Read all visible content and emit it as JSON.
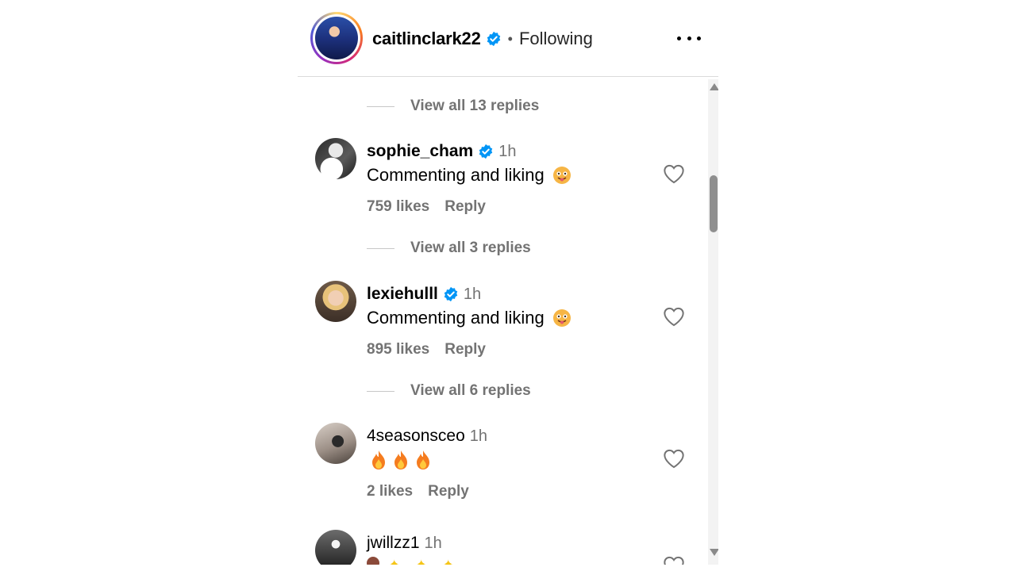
{
  "header": {
    "username": "caitlinclark22",
    "separator": "•",
    "follow_status": "Following",
    "more_label": "More options"
  },
  "threads": [
    {
      "view_replies": "View all 13 replies"
    },
    {
      "view_replies": "View all 3 replies"
    },
    {
      "view_replies": "View all 6 replies"
    }
  ],
  "comments": [
    {
      "username": "sophie_cham",
      "verified": true,
      "time": "1h",
      "text": "Commenting and liking",
      "emoji": "face-with-tongue",
      "likes": "759 likes",
      "reply": "Reply"
    },
    {
      "username": "lexiehulll",
      "verified": true,
      "time": "1h",
      "text": "Commenting and liking",
      "emoji": "face-with-tongue",
      "likes": "895 likes",
      "reply": "Reply"
    },
    {
      "username": "4seasonsceo",
      "verified": false,
      "time": "1h",
      "text": "",
      "emoji": "fire x3",
      "likes": "2 likes",
      "reply": "Reply"
    },
    {
      "username": "jwillzz1",
      "verified": false,
      "time": "1h",
      "text": "",
      "emoji": "partially visible",
      "likes": "",
      "reply": ""
    }
  ],
  "colors": {
    "verified_blue": "#0095f6",
    "secondary_text": "#737373",
    "divider": "#dbdbdb"
  }
}
